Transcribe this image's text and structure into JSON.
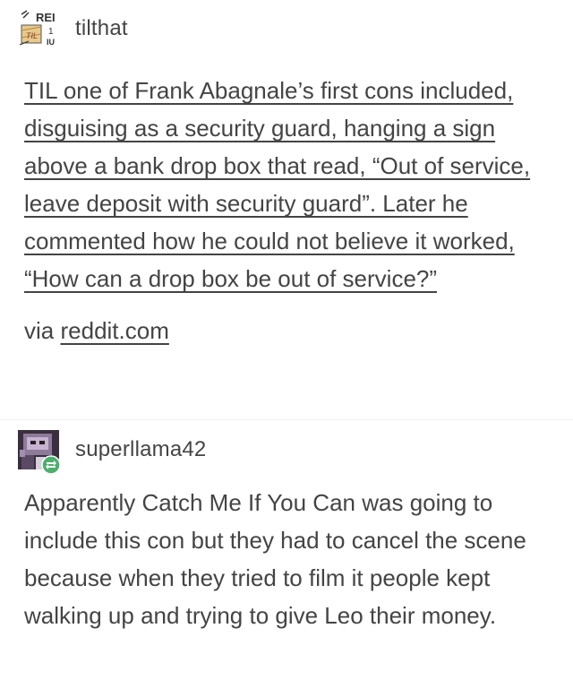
{
  "posts": [
    {
      "username": "tilthat",
      "avatar_icon": "reddit-til-logo-icon",
      "avatar_text": [
        "REI",
        "TIL",
        "IU"
      ],
      "body": "TIL one of Frank Abagnale’s first cons included, disguising as a security guard, hanging a sign above a bank drop box that read, “Out of service, leave deposit with security guard”. Later he commented how he could not believe it worked, “How can a drop box be out of service?”",
      "via_prefix": "via",
      "via_link": "reddit.com"
    },
    {
      "username": "superllama42",
      "avatar_icon": "llama-avatar-icon",
      "badge_icon": "reblog-icon",
      "body": "Apparently Catch Me If You Can was going to include this con but they had to cancel the scene because when they tried to film it people kept walking up and trying to give Leo their money."
    }
  ],
  "colors": {
    "text": "#444444",
    "reblog_badge": "#4caf6e"
  }
}
